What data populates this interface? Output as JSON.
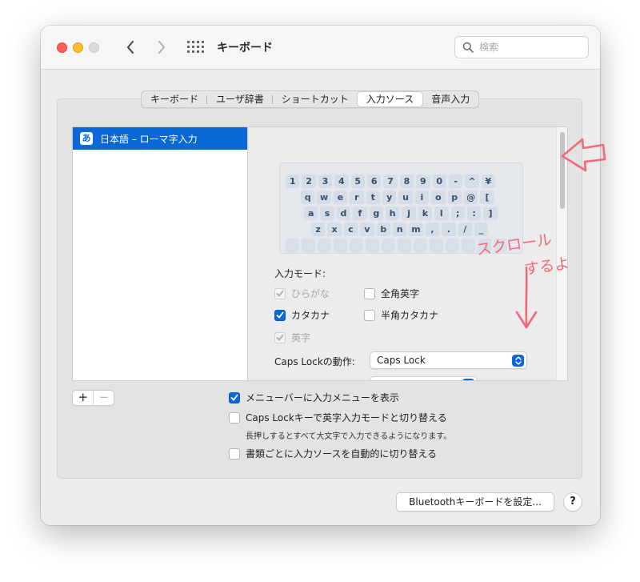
{
  "window": {
    "title": "キーボード",
    "search_placeholder": "検索"
  },
  "tabs": [
    {
      "label": "キーボード",
      "active": false
    },
    {
      "label": "ユーザ辞書",
      "active": false
    },
    {
      "label": "ショートカット",
      "active": false
    },
    {
      "label": "入力ソース",
      "active": true
    },
    {
      "label": "音声入力",
      "active": false
    }
  ],
  "input_sources": {
    "selected": {
      "icon_glyph": "あ",
      "label": "日本語 – ローマ字入力"
    }
  },
  "keyboard_rows": [
    [
      "1",
      "2",
      "3",
      "4",
      "5",
      "6",
      "7",
      "8",
      "9",
      "0",
      "-",
      "^",
      "¥"
    ],
    [
      "q",
      "w",
      "e",
      "r",
      "t",
      "y",
      "u",
      "i",
      "o",
      "p",
      "@",
      "["
    ],
    [
      "a",
      "s",
      "d",
      "f",
      "g",
      "h",
      "j",
      "k",
      "l",
      ";",
      ":",
      "]"
    ],
    [
      "z",
      "x",
      "c",
      "v",
      "b",
      "n",
      "m",
      ",",
      ".",
      "/",
      "_"
    ]
  ],
  "input_mode": {
    "label": "入力モード:",
    "options": [
      {
        "label": "ひらがな",
        "checked": true,
        "enabled": false
      },
      {
        "label": "全角英字",
        "checked": false,
        "enabled": true
      },
      {
        "label": "カタカナ",
        "checked": true,
        "enabled": true
      },
      {
        "label": "半角カタカナ",
        "checked": false,
        "enabled": true
      },
      {
        "label": "英字",
        "checked": true,
        "enabled": false
      }
    ]
  },
  "caps_lock": {
    "label": "Caps Lockの動作:",
    "value": "Caps Lock"
  },
  "list_buttons": {
    "add": "+",
    "remove": "−"
  },
  "options": {
    "show_menu": {
      "label": "メニューバーに入力メニューを表示",
      "checked": true
    },
    "caps_switch": {
      "label": "Caps Lockキーで英字入力モードと切り替える",
      "checked": false
    },
    "caps_note": "長押しするとすべて大文字で入力できるようになります。",
    "auto_switch": {
      "label": "書類ごとに入力ソースを自動的に切り替える",
      "checked": false
    }
  },
  "bottom": {
    "bluetooth_button": "Bluetoothキーボードを設定...",
    "help_button": "?"
  },
  "annotation": {
    "line1": "スクロール",
    "line2": "するよ",
    "color": "#f06a7a"
  },
  "colors": {
    "accent": "#0a67d8"
  }
}
